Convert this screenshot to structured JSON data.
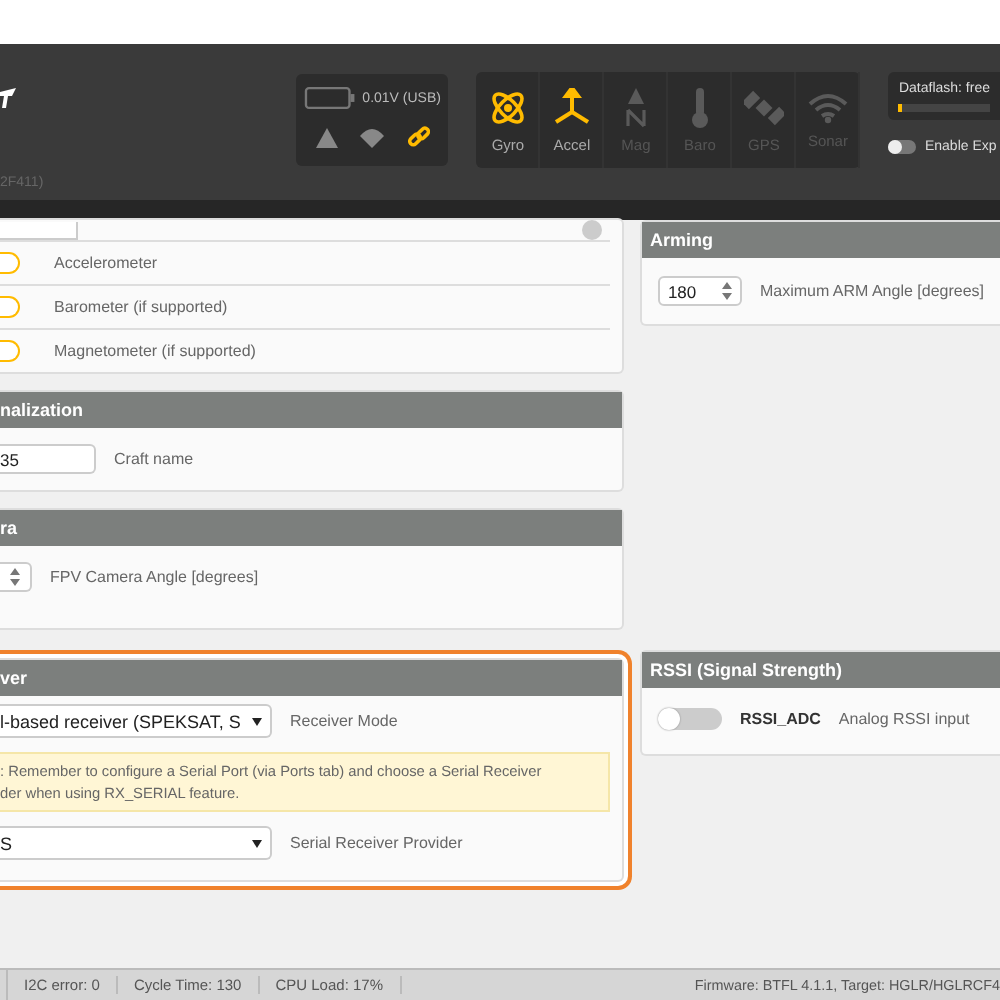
{
  "header": {
    "board_fragment": "2F411)"
  },
  "battery": {
    "reading": "0.01V (USB)"
  },
  "status_icons": [
    {
      "kind": "warning",
      "active": false
    },
    {
      "kind": "parachute",
      "active": false
    },
    {
      "kind": "link",
      "active": true
    }
  ],
  "sensors": [
    {
      "kind": "gyro",
      "label": "Gyro",
      "active": true
    },
    {
      "kind": "accel",
      "label": "Accel",
      "active": true
    },
    {
      "kind": "mag",
      "label": "Mag",
      "active": false
    },
    {
      "kind": "baro",
      "label": "Baro",
      "active": false
    },
    {
      "kind": "gps",
      "label": "GPS",
      "active": false
    },
    {
      "kind": "sonar",
      "label": "Sonar",
      "active": false
    }
  ],
  "dataflash": {
    "label": "Dataflash: free",
    "level": 0.03
  },
  "expert_mode": {
    "label": "Enable Exp",
    "on": false
  },
  "sensor_toggles": [
    {
      "label": "Accelerometer",
      "on": true
    },
    {
      "label": "Barometer (if supported)",
      "on": true
    },
    {
      "label": "Magnetometer (if supported)",
      "on": true
    }
  ],
  "personalization": {
    "title": "nalization",
    "value": "35",
    "label": "Craft name"
  },
  "camera": {
    "title": "ra",
    "label": "FPV Camera Angle [degrees]"
  },
  "arming": {
    "title": "Arming",
    "value": "180",
    "label": "Maximum ARM Angle [degrees]"
  },
  "receiver": {
    "title": "ver",
    "highlighted": true,
    "mode_value": "l-based receiver (SPEKSAT, S",
    "mode_label": "Receiver Mode",
    "note_lines": [
      ": Remember to configure a Serial Port (via Ports tab) and choose a Serial Receiver",
      "der when using RX_SERIAL feature."
    ],
    "provider_value": "S",
    "provider_label": "Serial Receiver Provider"
  },
  "rssi": {
    "title": "RSSI (Signal Strength)",
    "on": false,
    "name": "RSSI_ADC",
    "description": "Analog RSSI input"
  },
  "status_bar": {
    "items": [
      "I2C error: 0",
      "Cycle Time: 130",
      "CPU Load: 17%"
    ],
    "firmware": "Firmware: BTFL 4.1.1, Target: HGLR/HGLRCF4"
  }
}
